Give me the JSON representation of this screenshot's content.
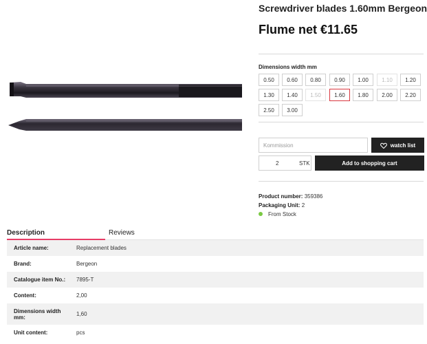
{
  "product": {
    "title": "Screwdriver blades 1.60mm Bergeon",
    "price": "Flume net €11.65"
  },
  "dimensions": {
    "label": "Dimensions width mm",
    "options": [
      {
        "value": "0.50",
        "state": "normal"
      },
      {
        "value": "0.60",
        "state": "normal"
      },
      {
        "value": "0.80",
        "state": "normal"
      },
      {
        "value": "0.90",
        "state": "normal"
      },
      {
        "value": "1.00",
        "state": "normal"
      },
      {
        "value": "1.10",
        "state": "disabled"
      },
      {
        "value": "1.20",
        "state": "normal"
      },
      {
        "value": "1.30",
        "state": "normal"
      },
      {
        "value": "1.40",
        "state": "normal"
      },
      {
        "value": "1.50",
        "state": "disabled"
      },
      {
        "value": "1.60",
        "state": "selected"
      },
      {
        "value": "1.80",
        "state": "normal"
      },
      {
        "value": "2.00",
        "state": "normal"
      },
      {
        "value": "2.20",
        "state": "normal"
      },
      {
        "value": "2.50",
        "state": "normal"
      },
      {
        "value": "3.00",
        "state": "normal"
      }
    ],
    "selected_color": "#d9363e"
  },
  "actions": {
    "kommission_placeholder": "Kommission",
    "watch_label": "watch list",
    "quantity": "2",
    "unit": "STK",
    "add_label": "Add to shopping cart"
  },
  "info": {
    "product_number_label": "Product number:",
    "product_number": "359386",
    "packaging_label": "Packaging Unit:",
    "packaging_value": "2",
    "stock": "From Stock",
    "stock_color": "#7ac943"
  },
  "tabs": {
    "description": "Description",
    "reviews": "Reviews",
    "accent": "#e73c66"
  },
  "specs": [
    {
      "key": "Article name:",
      "value": "Replacement blades"
    },
    {
      "key": "Brand:",
      "value": "Bergeon"
    },
    {
      "key": "Catalogue item No.:",
      "value": "7895-T"
    },
    {
      "key": "Content:",
      "value": "2,00"
    },
    {
      "key": "Dimensions width mm:",
      "value": "1,60"
    },
    {
      "key": "Unit content:",
      "value": "pcs"
    }
  ]
}
